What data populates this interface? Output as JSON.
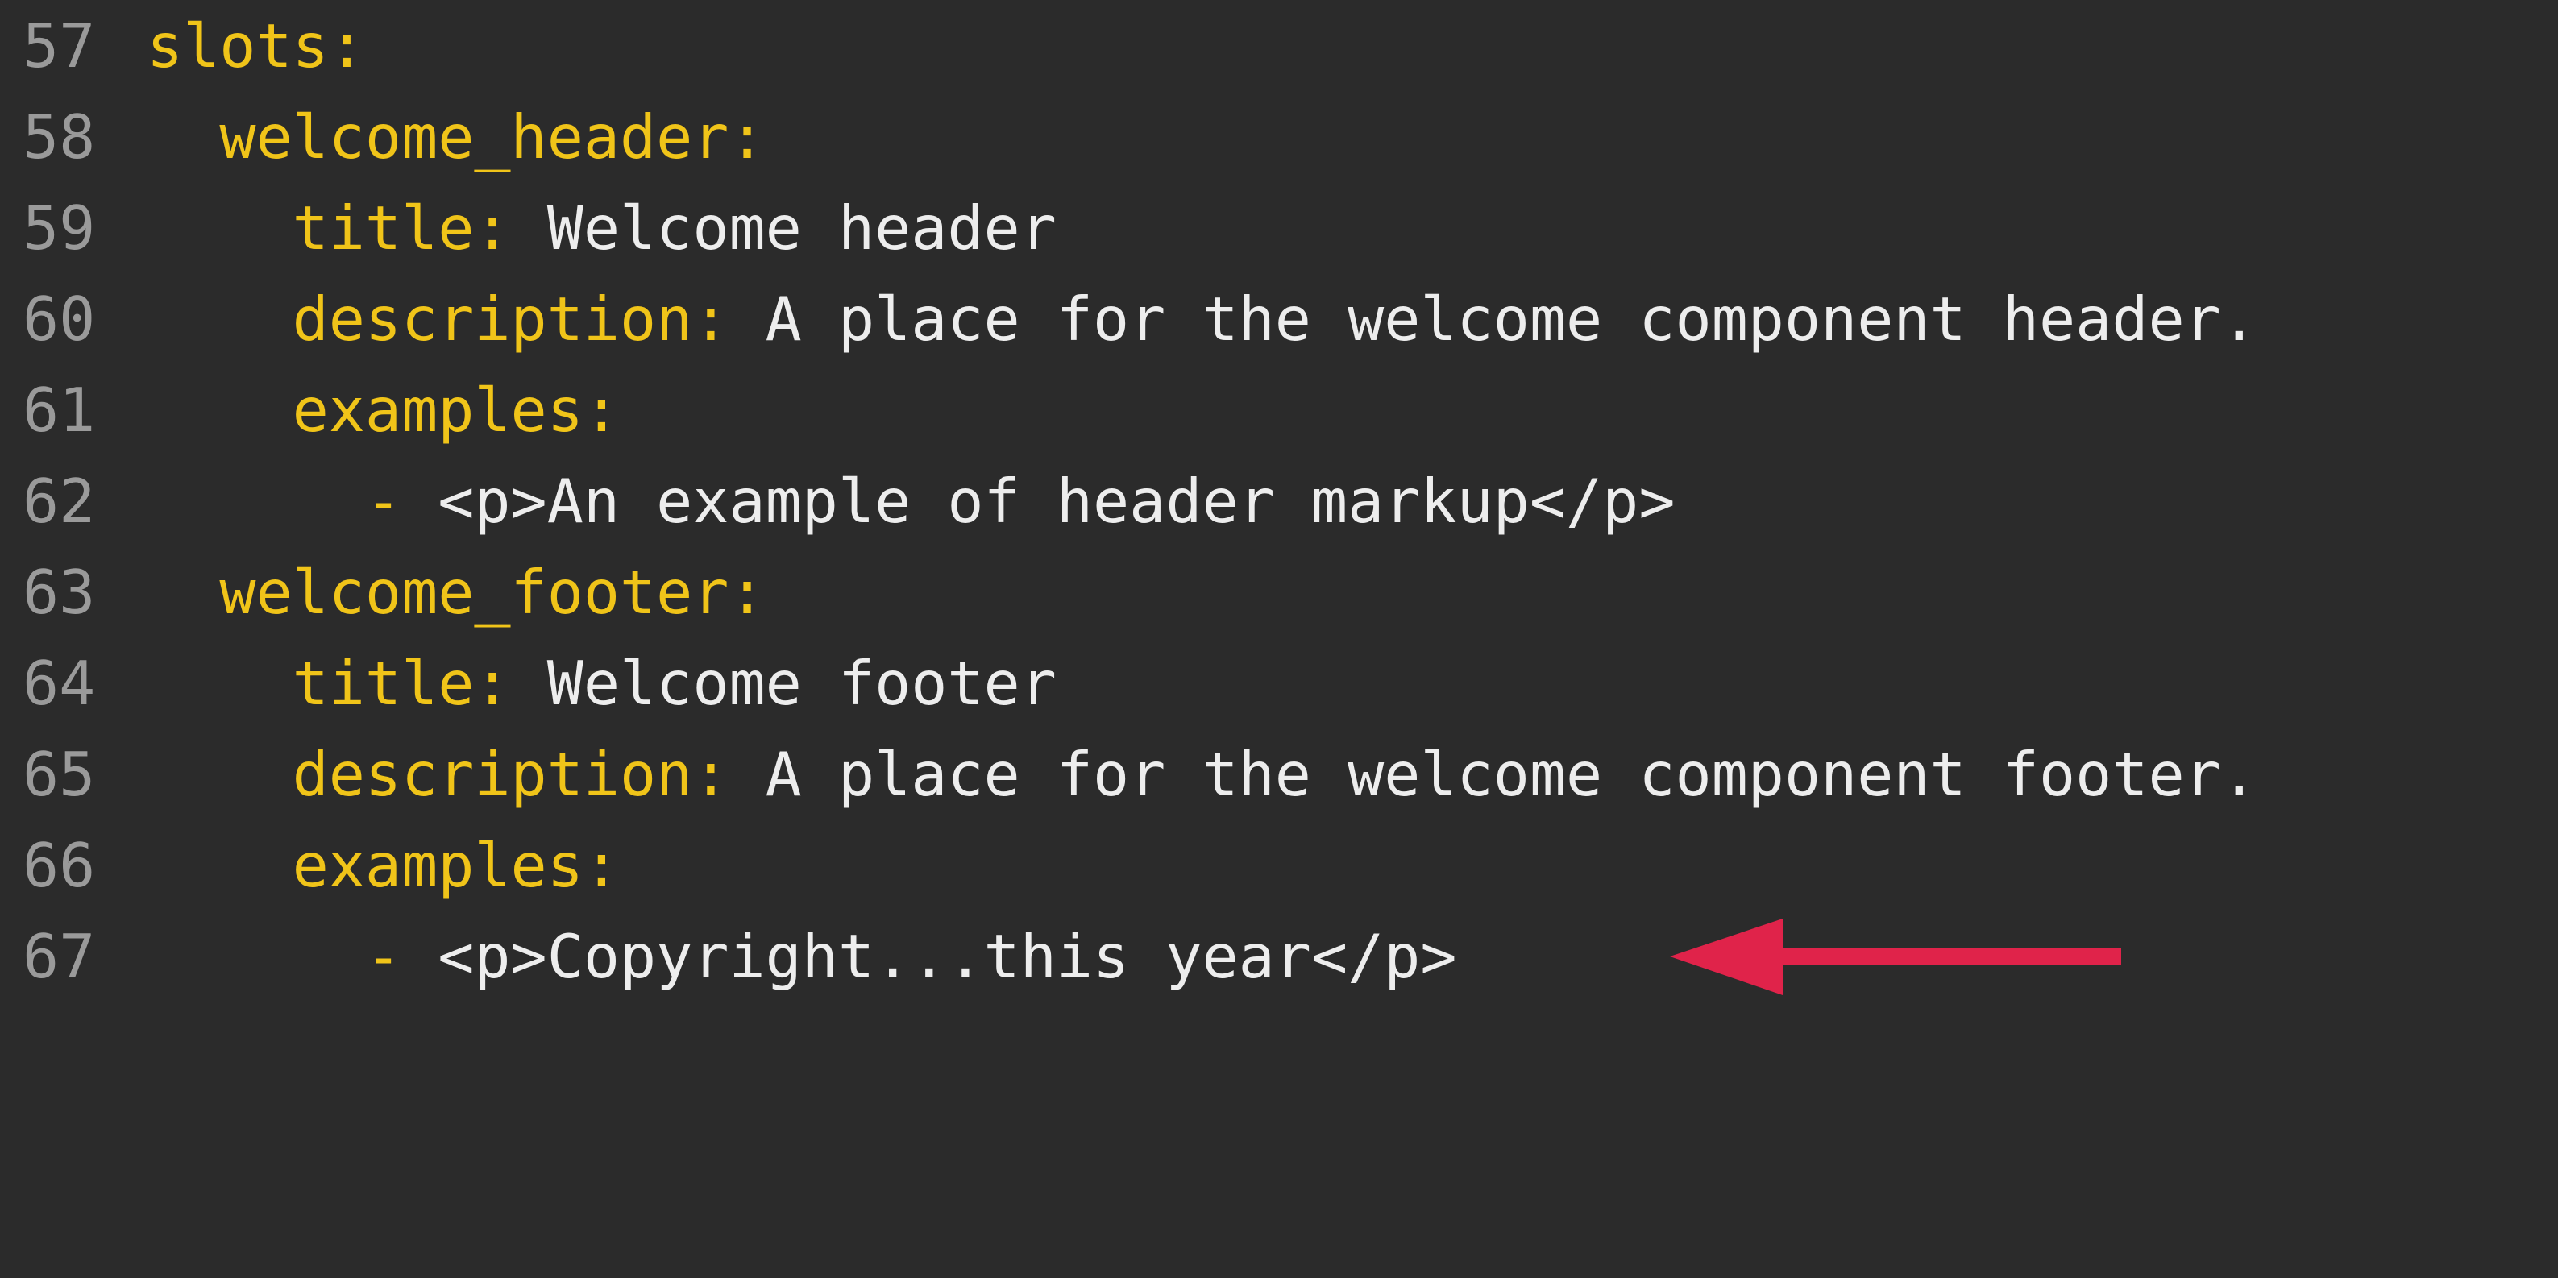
{
  "colors": {
    "background": "#2b2b2b",
    "line_number": "#9a9a9a",
    "key": "#f0c419",
    "value": "#ededed",
    "arrow": "#e0234a"
  },
  "lines": [
    {
      "number": "57",
      "indent": "",
      "key": "slots:",
      "value": ""
    },
    {
      "number": "58",
      "indent": "  ",
      "key": "welcome_header:",
      "value": ""
    },
    {
      "number": "59",
      "indent": "    ",
      "key": "title:",
      "value": " Welcome header"
    },
    {
      "number": "60",
      "indent": "    ",
      "key": "description:",
      "value": " A place for the welcome component header."
    },
    {
      "number": "61",
      "indent": "    ",
      "key": "examples:",
      "value": ""
    },
    {
      "number": "62",
      "indent": "      ",
      "key": "-",
      "value": " <p>An example of header markup</p>"
    },
    {
      "number": "63",
      "indent": "  ",
      "key": "welcome_footer:",
      "value": ""
    },
    {
      "number": "64",
      "indent": "    ",
      "key": "title:",
      "value": " Welcome footer"
    },
    {
      "number": "65",
      "indent": "    ",
      "key": "description:",
      "value": " A place for the welcome component footer."
    },
    {
      "number": "66",
      "indent": "    ",
      "key": "examples:",
      "value": ""
    },
    {
      "number": "67",
      "indent": "      ",
      "key": "-",
      "value": " <p>Copyright...this year</p>"
    }
  ],
  "annotation": {
    "icon": "left-arrow-icon",
    "points_to_line": "67"
  }
}
